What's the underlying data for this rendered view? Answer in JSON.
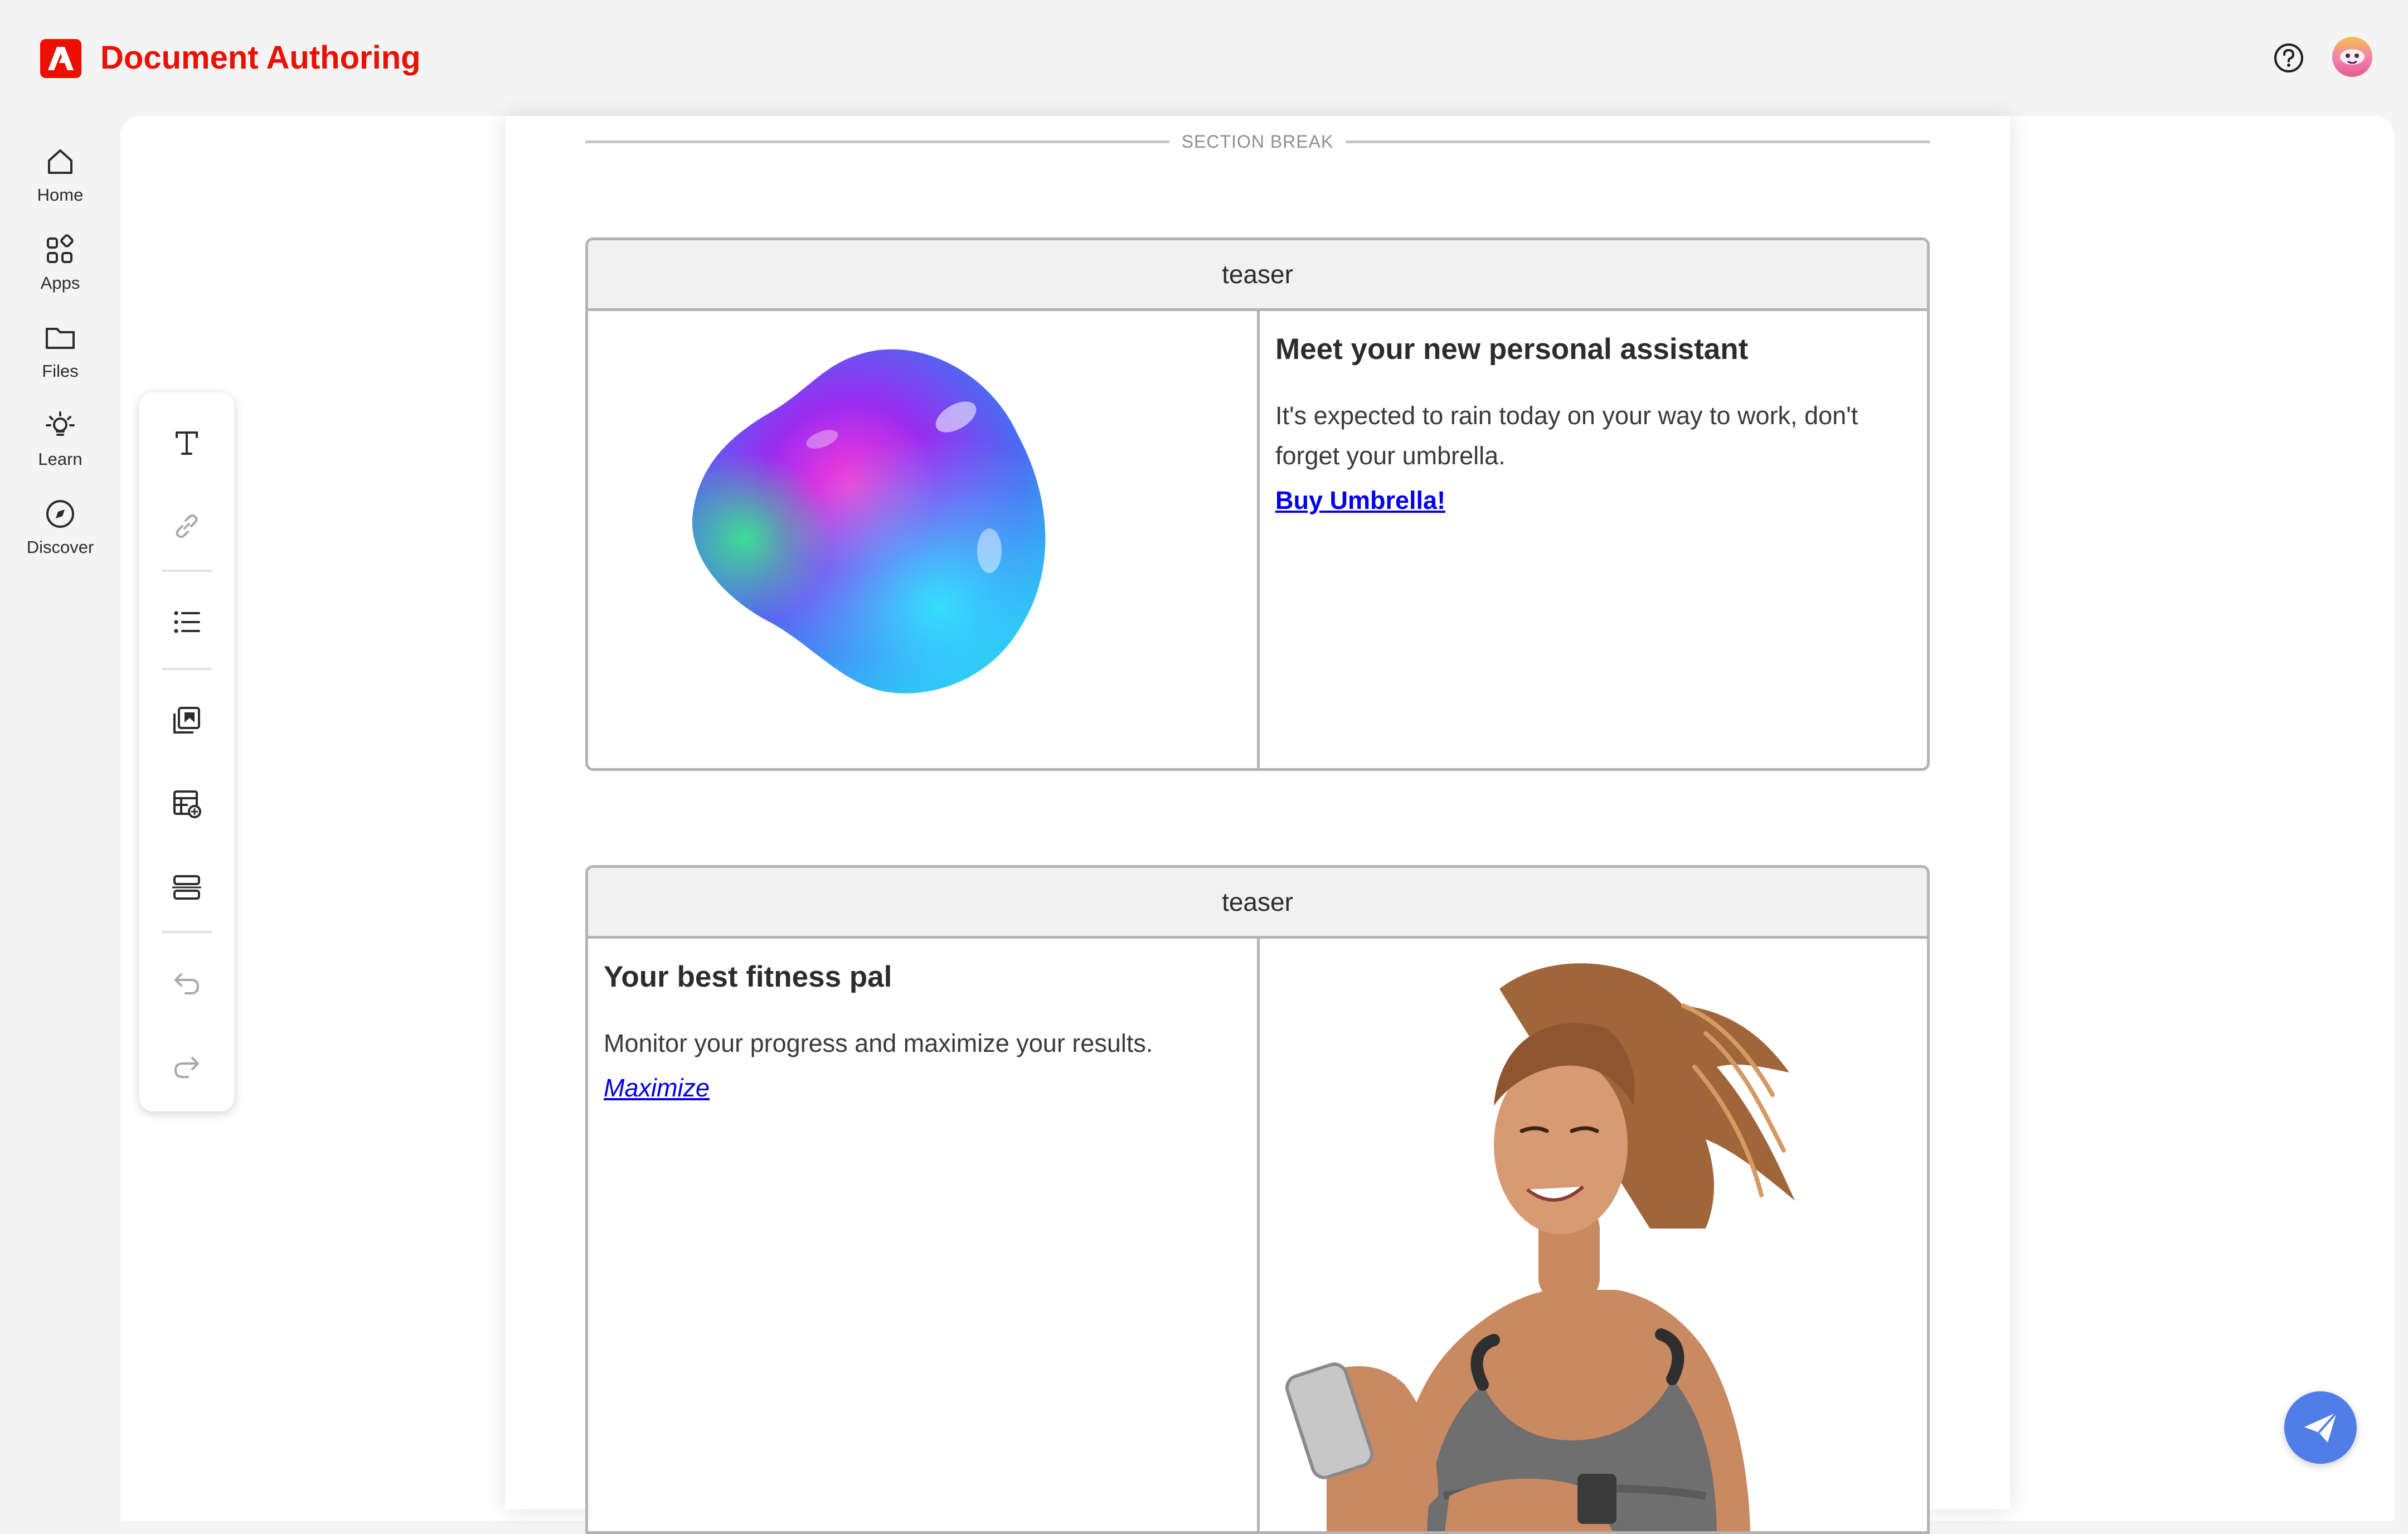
{
  "app": {
    "title": "Document Authoring",
    "brand_color": "#eb1000"
  },
  "header": {
    "help_icon": "help-icon",
    "avatar_icon": "user-avatar"
  },
  "rail": {
    "items": [
      {
        "label": "Home",
        "icon": "home-icon"
      },
      {
        "label": "Apps",
        "icon": "apps-icon"
      },
      {
        "label": "Files",
        "icon": "folder-icon"
      },
      {
        "label": "Learn",
        "icon": "lightbulb-icon"
      },
      {
        "label": "Discover",
        "icon": "compass-icon"
      }
    ]
  },
  "toolbar": {
    "tools": [
      "text-icon",
      "link-icon",
      "list-icon",
      "image-icon",
      "table-icon",
      "section-icon",
      "undo-icon",
      "redo-icon"
    ]
  },
  "document": {
    "section_break_label": "SECTION BREAK",
    "blocks": [
      {
        "name": "teaser",
        "title": "Meet your new personal assistant",
        "body": "It's expected to rain today on your way to work, don't forget your umbrella.",
        "link": "Buy Umbrella!",
        "image": "iridescent-blob-image"
      },
      {
        "name": "teaser",
        "title": "Your best fitness pal",
        "body": "Monitor your progress and maximize your results.",
        "link": "Maximize",
        "image": "woman-running-with-phone-image"
      }
    ]
  },
  "fab": {
    "icon": "send-icon",
    "color": "#4f7ee8"
  }
}
